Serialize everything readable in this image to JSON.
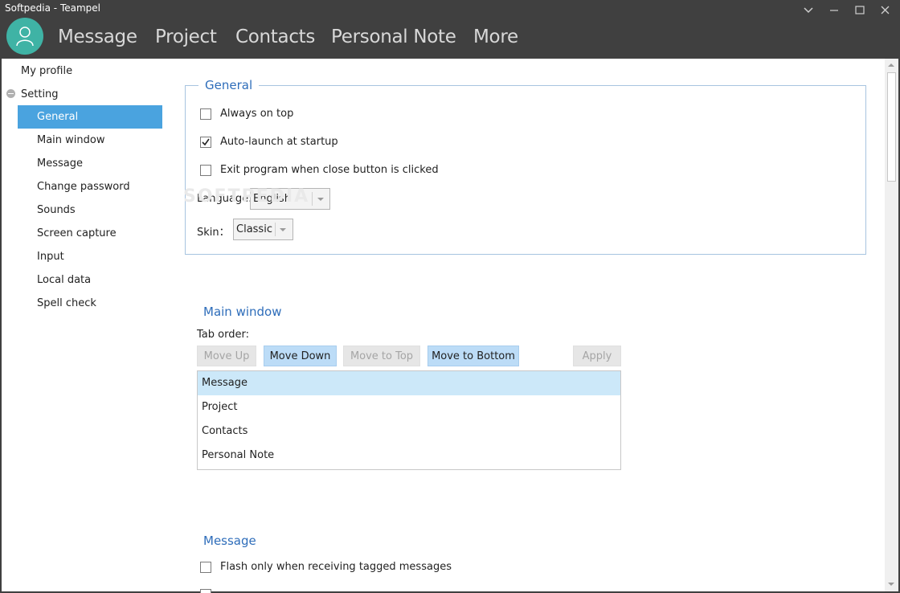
{
  "window": {
    "title": "Softpedia - Teampel"
  },
  "nav": {
    "tabs": [
      "Message",
      "Project",
      "Contacts",
      "Personal Note",
      "More"
    ]
  },
  "sidebar": {
    "my_profile": "My profile",
    "setting": "Setting",
    "items": [
      "General",
      "Main window",
      "Message",
      "Change password",
      "Sounds",
      "Screen capture",
      "Input",
      "Local data",
      "Spell check"
    ],
    "selected": "General"
  },
  "general": {
    "title": "General",
    "always_on_top": {
      "label": "Always on top",
      "checked": false
    },
    "auto_launch": {
      "label": "Auto-launch at startup",
      "checked": true
    },
    "exit_program": {
      "label": "Exit program when close button is clicked",
      "checked": false
    },
    "language_label": "Language:",
    "language_value": "English",
    "skin_label": "Skin：",
    "skin_value": "Classic"
  },
  "main_window": {
    "title": "Main window",
    "tab_order_label": "Tab order:",
    "buttons": {
      "move_up": "Move Up",
      "move_down": "Move Down",
      "move_to_top": "Move to Top",
      "move_to_bottom": "Move to Bottom",
      "apply": "Apply"
    },
    "list": [
      "Message",
      "Project",
      "Contacts",
      "Personal Note"
    ],
    "selected": "Message"
  },
  "message": {
    "title": "Message",
    "flash_only": {
      "label": "Flash only when receiving tagged messages",
      "checked": false
    }
  },
  "watermark": "SOFTPEDIA",
  "colors": {
    "titlebar": "#404040",
    "accent": "#4aa3df",
    "section_title": "#2e6dba",
    "avatar": "#3fb3a5"
  },
  "icons": {
    "avatar": "user-icon",
    "minimize": "minimize-icon",
    "maximize": "maximize-icon",
    "close": "close-icon",
    "collapse": "chevron-down-icon"
  }
}
